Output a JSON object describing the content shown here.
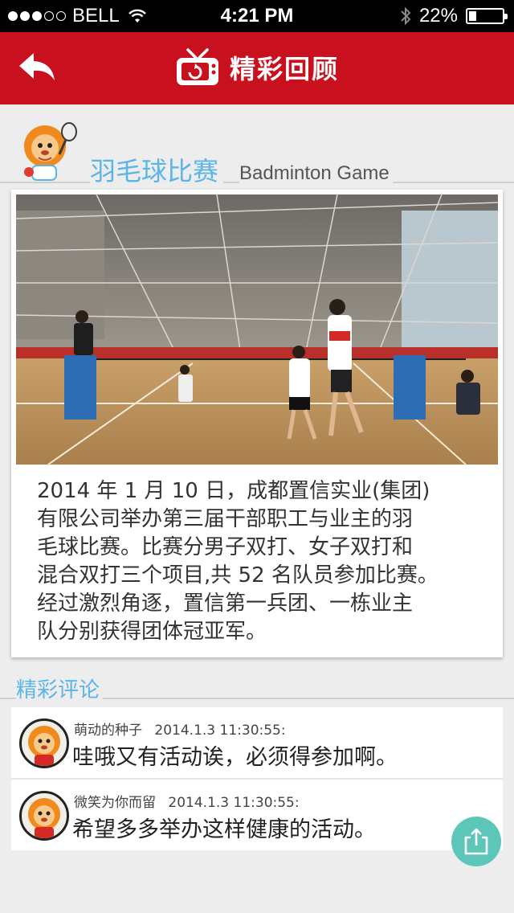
{
  "status_bar": {
    "carrier": "BELL",
    "time": "4:21 PM",
    "battery": "22%",
    "battery_level": 0.22
  },
  "nav": {
    "title": "精彩回顾",
    "back_icon": "back-arrow-icon",
    "title_icon": "tv-icon",
    "bar_color": "#c8101e"
  },
  "section": {
    "title_cn": "羽毛球比赛",
    "title_en": "Badminton Game",
    "accent_color": "#5ab6ea"
  },
  "article": {
    "lines": [
      "2014 年 1 月 10 日，成都置信实业(集团)",
      "有限公司举办第三届干部职工与业主的羽",
      "毛球比赛。比赛分男子双打、女子双打和",
      "混合双打三个项目,共 52 名队员参加比赛。",
      "经过激烈角逐，置信第一兵团、一栋业主",
      "队分别获得团体冠亚军。"
    ]
  },
  "comments": {
    "title": "精彩评论",
    "items": [
      {
        "user": "萌动的种子",
        "time": "2014.1.3  11:30:55:",
        "text": "哇哦又有活动诶，必须得参加啊。"
      },
      {
        "user": "微笑为你而留",
        "time": "2014.1.3  11:30:55:",
        "text": "希望多多举办这样健康的活动。"
      }
    ]
  },
  "share": {
    "icon": "share-icon",
    "color": "#5cc6b8"
  }
}
